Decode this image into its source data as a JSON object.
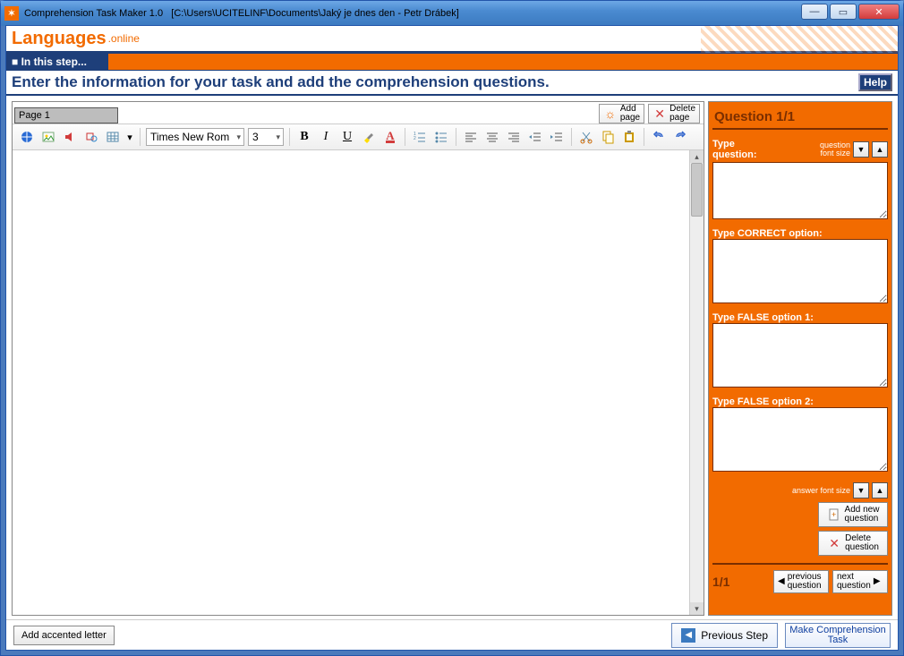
{
  "window": {
    "title": "Comprehension Task Maker 1.0   [C:\\Users\\UCITELINF\\Documents\\Jaký je dnes den - Petr Drábek]",
    "app_icon_glyph": "✶"
  },
  "brand": {
    "part1": "Languages",
    "part2": ".online"
  },
  "step": {
    "label": "■ In this step..."
  },
  "instruction": "Enter the information for your task and add the comprehension questions.",
  "help_label": "Help",
  "editor": {
    "page_tab": "Page 1",
    "add_page": "Add\npage",
    "delete_page": "Delete\npage",
    "font_name": "Times New Rom",
    "font_size": "3",
    "content": ""
  },
  "toolbar_icons": {
    "globe": "globe-icon",
    "image": "image-icon",
    "sound": "sound-icon",
    "shape": "shape-icon",
    "table": "table-icon",
    "bold": "B",
    "italic": "I",
    "underline": "U",
    "highlight": "highlight-icon",
    "fontcolor": "fontcolor-icon",
    "ol": "ol-icon",
    "ul": "ul-icon",
    "align_left": "align-left-icon",
    "align_center": "align-center-icon",
    "align_right": "align-right-icon",
    "indent_dec": "indent-dec-icon",
    "indent_inc": "indent-inc-icon",
    "cut": "cut-icon",
    "copy": "copy-icon",
    "paste": "paste-icon",
    "undo": "undo-icon",
    "redo": "redo-icon"
  },
  "question_panel": {
    "header": "Question 1/1",
    "type_question_label": "Type\nquestion:",
    "question_font_size_label": "question\nfont size",
    "correct_label": "Type CORRECT option:",
    "false1_label": "Type FALSE option 1:",
    "false2_label": "Type FALSE option 2:",
    "answer_font_size_label": "answer font size",
    "add_new_label": "Add new\nquestion",
    "delete_label": "Delete\nquestion",
    "counter": "1/1",
    "prev_label": "previous\nquestion",
    "next_label": "next\nquestion",
    "question_value": "",
    "correct_value": "",
    "false1_value": "",
    "false2_value": ""
  },
  "footer": {
    "accent_btn": "Add accented letter",
    "prev_step": "Previous Step",
    "make_task": "Make Comprehension\nTask"
  }
}
